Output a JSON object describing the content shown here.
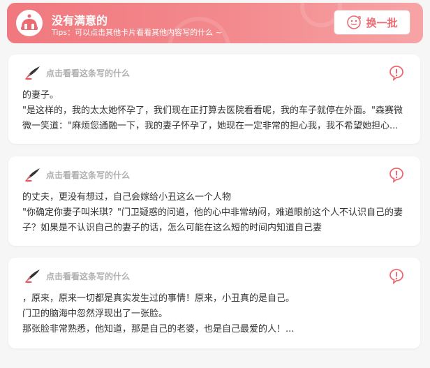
{
  "banner": {
    "title": "没有满意的",
    "tip": "Tips：可以点击其他卡片看看其他内容写的什么 ~",
    "swap_label": "换一批"
  },
  "cards": [
    {
      "hint": "点击看看这条写的什么",
      "lines": [
        "的妻子。",
        "\"是这样的，我的太太她怀孕了，我们现在正打算去医院看看呢，我的车子就停在外面。\"森赛微",
        "微一笑道：\"麻烦您通融一下，我的妻子怀孕了，她现在一定非常的担心我，我不希望她担心..."
      ]
    },
    {
      "hint": "点击看看这条写的什么",
      "lines": [
        "的丈夫，更没有想过，自己会嫁给小丑这么一个人物",
        "\"你确定你妻子叫米琪？\"门卫疑惑的问道，他的心中非常纳闷，难道眼前这个人不认识自己的妻",
        "子？如果是不认识自己的妻子的话，怎么可能在这么短的时间内知道自己妻"
      ]
    },
    {
      "hint": "点击看看这条写的什么",
      "lines": [
        "，原来，原来一切都是真实发生过的事情！原来，小丑真的是自己。",
        "门卫的脑海中忽然浮现出了一张脸。",
        "那张脸非常熟悉，他知道，那是自己的老婆，也是自己最爱的人！..."
      ]
    }
  ],
  "colors": {
    "accent": "#ec6a71",
    "banner_start": "#f0787e",
    "banner_end": "#f7a4a6"
  }
}
